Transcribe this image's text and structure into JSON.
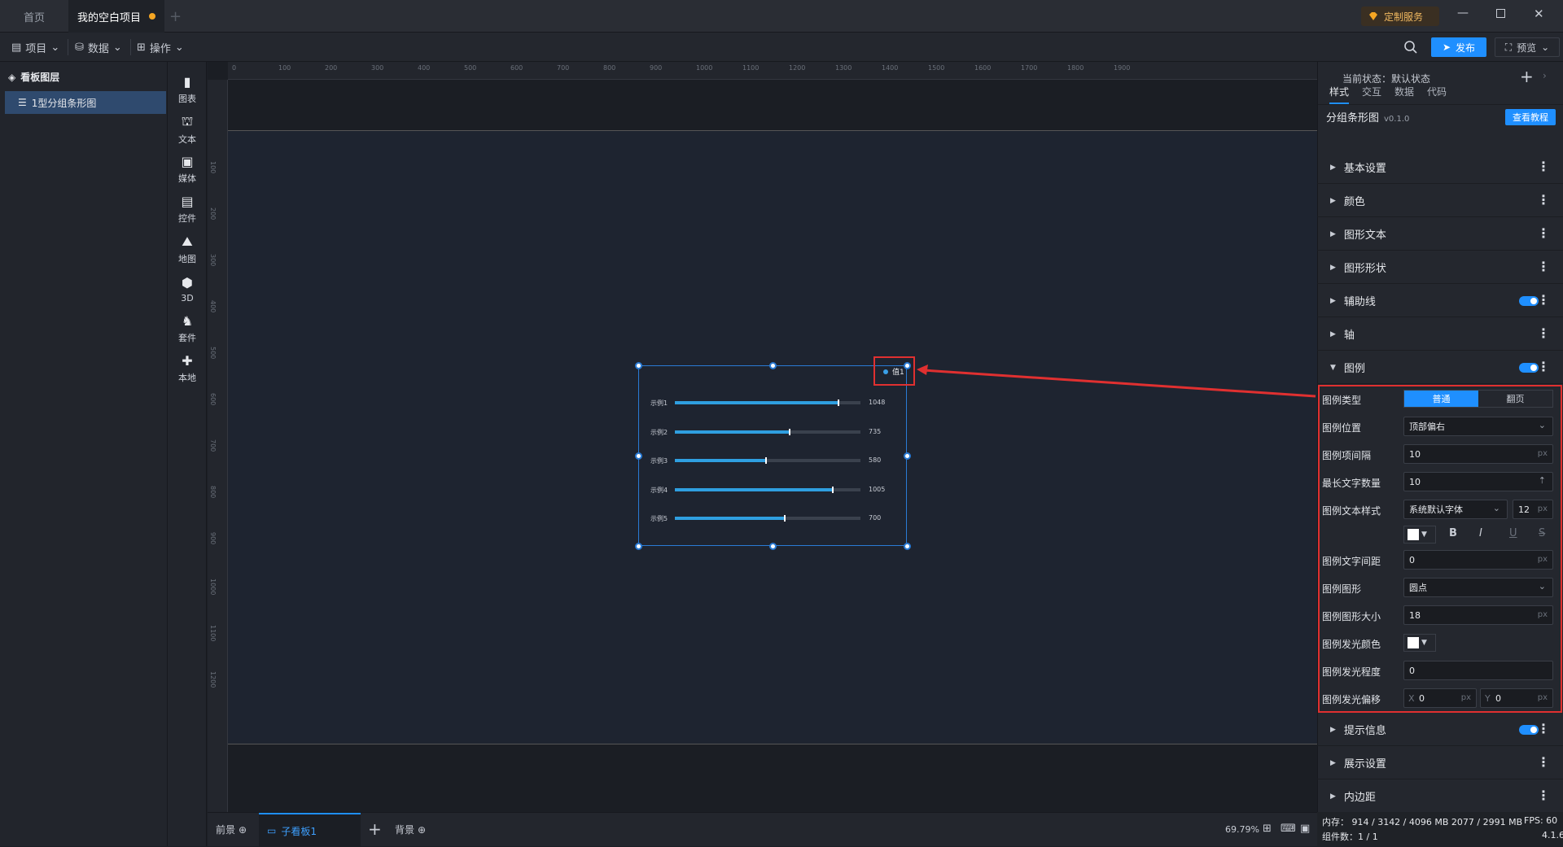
{
  "tabs": {
    "home": "首页",
    "project": "我的空白项目"
  },
  "topright": {
    "custom_service": "定制服务"
  },
  "toolbar": {
    "project": "项目",
    "data": "数据",
    "operate": "操作",
    "publish": "发布",
    "preview": "预览"
  },
  "layers": {
    "title": "看板图层",
    "item": "1型分组条形图"
  },
  "iconbar": [
    "图表",
    "文本",
    "媒体",
    "控件",
    "地图",
    "3D",
    "套件",
    "本地"
  ],
  "ruler": {
    "top": [
      "0",
      "100",
      "200",
      "300",
      "400",
      "500",
      "600",
      "700",
      "800",
      "900",
      "1000",
      "1100",
      "1200",
      "1300",
      "1400",
      "1500",
      "1600",
      "1700",
      "1800",
      "1900"
    ],
    "left": [
      "100",
      "200",
      "300",
      "400",
      "500",
      "600",
      "700",
      "800",
      "900",
      "1000",
      "1100",
      "1200"
    ]
  },
  "chart": {
    "legend": "值1",
    "rows": [
      {
        "label": "示例1",
        "value": "1048",
        "frac": 0.88
      },
      {
        "label": "示例2",
        "value": "735",
        "frac": 0.62
      },
      {
        "label": "示例3",
        "value": "580",
        "frac": 0.49
      },
      {
        "label": "示例4",
        "value": "1005",
        "frac": 0.85
      },
      {
        "label": "示例5",
        "value": "700",
        "frac": 0.59
      }
    ]
  },
  "bottom": {
    "front": "前景",
    "sub": "子看板1",
    "back": "背景",
    "zoom": "69.79%"
  },
  "panel": {
    "state_label": "当前状态：",
    "state_value": "默认状态",
    "tabs": [
      "样式",
      "交互",
      "数据",
      "代码"
    ],
    "comp_name": "分组条形图",
    "comp_ver": "v0.1.0",
    "tutorial": "查看教程",
    "sections_top": [
      "基本设置",
      "颜色",
      "图形文本",
      "图形形状",
      "辅助线",
      "轴",
      "图例"
    ],
    "sections_bottom": [
      "提示信息",
      "展示设置",
      "内边距"
    ],
    "legend_type_label": "图例类型",
    "legend_type_opts": [
      "普通",
      "翻页"
    ],
    "legend_pos_label": "图例位置",
    "legend_pos_val": "顶部偏右",
    "item_gap_label": "图例项间隔",
    "item_gap_val": "10",
    "max_text_label": "最长文字数量",
    "max_text_val": "10",
    "text_style_label": "图例文本样式",
    "font_val": "系统默认字体",
    "font_size": "12",
    "text_gap_label": "图例文字间距",
    "text_gap_val": "0",
    "shape_label": "图例图形",
    "shape_val": "圆点",
    "shape_size_label": "图例图形大小",
    "shape_size_val": "18",
    "glow_color_label": "图例发光颜色",
    "glow_level_label": "图例发光程度",
    "glow_level_val": "0",
    "glow_offset_label": "图例发光偏移",
    "glow_x": "0",
    "glow_y": "0",
    "unit_px": "px",
    "x_label": "X",
    "y_label": "Y"
  },
  "status": {
    "mem": "内存： 914 / 3142 / 4096 MB  2077 / 2991 MB",
    "fps": "FPS:  60",
    "count": "组件数：1 / 1",
    "version": "4.1.6"
  }
}
